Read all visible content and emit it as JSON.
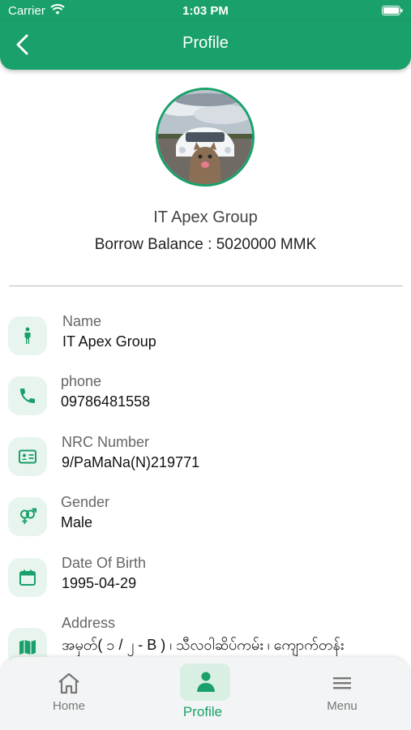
{
  "status_bar": {
    "carrier": "Carrier",
    "time": "1:03 PM"
  },
  "app_bar": {
    "title": "Profile"
  },
  "profile": {
    "company_name": "IT Apex Group",
    "balance_label": "Borrow Balance : ",
    "balance_value": "5020000 MMK"
  },
  "fields": [
    {
      "label": "Name",
      "value": "IT Apex Group",
      "icon": "person-icon"
    },
    {
      "label": "phone",
      "value": "09786481558",
      "icon": "phone-icon"
    },
    {
      "label": "NRC Number",
      "value": "9/PaMaNa(N)219771",
      "icon": "id-card-icon"
    },
    {
      "label": "Gender",
      "value": "Male",
      "icon": "gender-icon"
    },
    {
      "label": "Date Of Birth",
      "value": "1995-04-29",
      "icon": "calendar-icon"
    },
    {
      "label": "Address",
      "value": "အမှတ်( ၁ / ၂ - B ) ၊ သီလဝါဆိပ်ကမ်း ၊ ကျောက်တန်း",
      "icon": "map-icon"
    }
  ],
  "bottom_nav": [
    {
      "label": "Home",
      "icon": "home-icon",
      "active": false
    },
    {
      "label": "Profile",
      "icon": "person-icon",
      "active": true
    },
    {
      "label": "Menu",
      "icon": "menu-icon",
      "active": false
    }
  ],
  "colors": {
    "primary": "#1aa06a",
    "icon_bg": "#e8f5ee",
    "nav_bg": "#f3f4f5"
  }
}
